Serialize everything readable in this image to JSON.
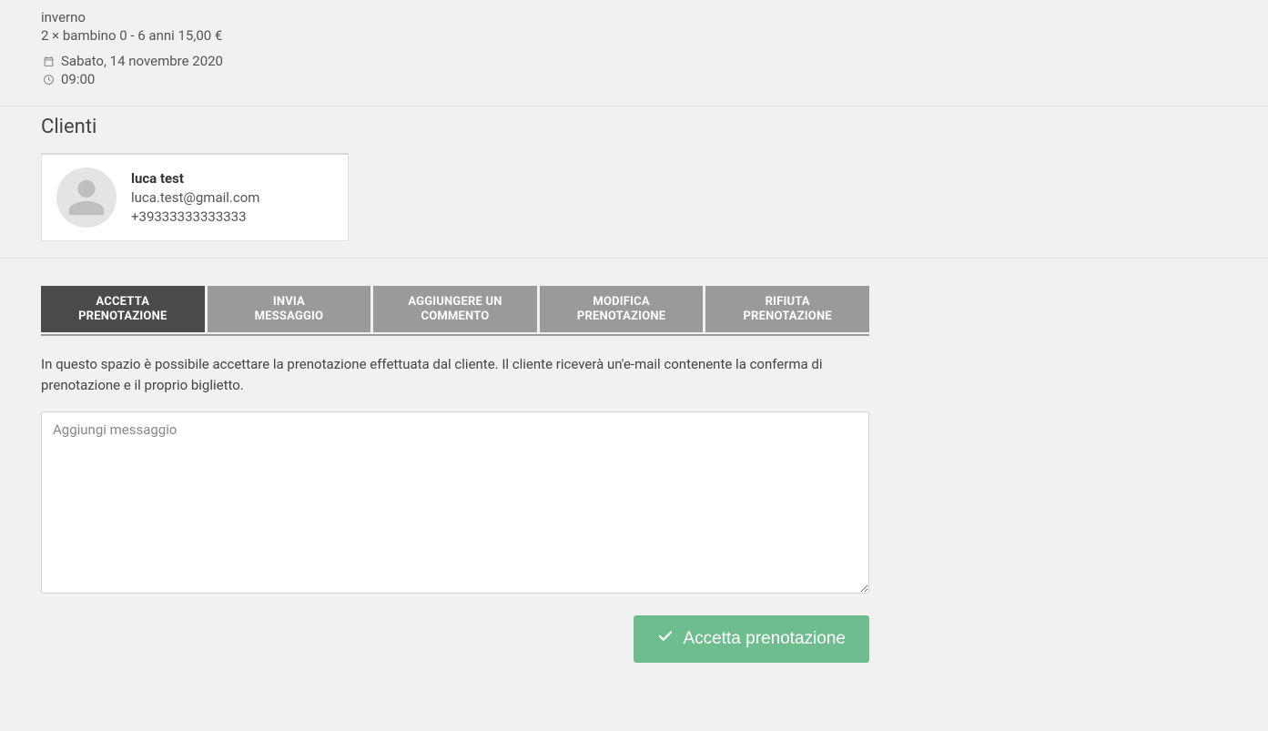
{
  "booking": {
    "line1": "inverno",
    "line2": "2 × bambino 0 - 6 anni 15,00 €",
    "date": "Sabato, 14 novembre 2020",
    "time": "09:00"
  },
  "clients": {
    "heading": "Clienti",
    "items": [
      {
        "name": "luca test",
        "email": "luca.test@gmail.com",
        "phone": "+39333333333333"
      }
    ]
  },
  "tabs": {
    "items": [
      {
        "label": "ACCETTA\nPRENOTAZIONE",
        "active": true
      },
      {
        "label": "INVIA\nMESSAGGIO",
        "active": false
      },
      {
        "label": "AGGIUNGERE UN\nCOMMENTO",
        "active": false
      },
      {
        "label": "MODIFICA\nPRENOTAZIONE",
        "active": false
      },
      {
        "label": "RIFIUTA\nPRENOTAZIONE",
        "active": false
      }
    ]
  },
  "panel": {
    "description": "In questo spazio è possibile accettare la prenotazione effettuata dal cliente. Il cliente riceverà un'e-mail contenente la conferma di prenotazione e il proprio biglietto.",
    "placeholder": "Aggiungi messaggio",
    "submit_label": "Accetta prenotazione"
  }
}
